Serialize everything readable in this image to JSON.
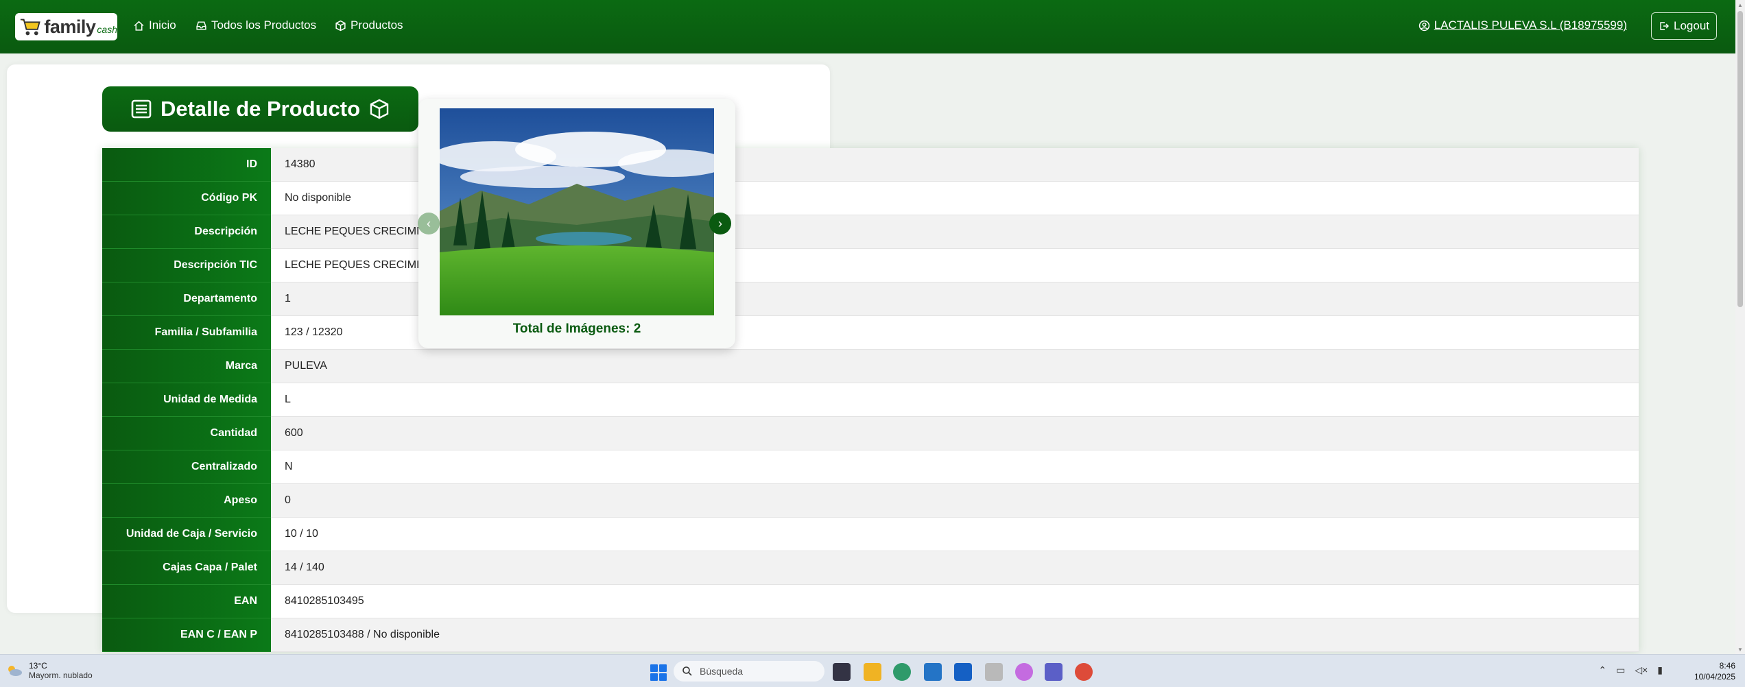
{
  "navbar": {
    "logo": {
      "word1": "family",
      "word2": "cash"
    },
    "items": [
      {
        "label": "Inicio",
        "icon": "home-icon"
      },
      {
        "label": "Todos los Productos",
        "icon": "inbox-icon"
      },
      {
        "label": "Productos",
        "icon": "box-icon"
      }
    ],
    "user": "LACTALIS PULEVA S.L (B18975599)",
    "logout": "Logout",
    "accent": "#0b6a12"
  },
  "title": "Detalle de Producto",
  "details": [
    {
      "label": "ID",
      "value": "14380"
    },
    {
      "label": "Código PK",
      "value": "No disponible"
    },
    {
      "label": "Descripción",
      "value": "LECHE PEQUES CRECIMIENTO"
    },
    {
      "label": "Descripción TIC",
      "value": "LECHE PEQUES CRECIMI"
    },
    {
      "label": "Departamento",
      "value": "1"
    },
    {
      "label": "Familia / Subfamilia",
      "value": "123 / 12320"
    },
    {
      "label": "Marca",
      "value": "PULEVA"
    },
    {
      "label": "Unidad de Medida",
      "value": "L"
    },
    {
      "label": "Cantidad",
      "value": "600"
    },
    {
      "label": "Centralizado",
      "value": "N"
    },
    {
      "label": "Apeso",
      "value": "0"
    },
    {
      "label": "Unidad de Caja / Servicio",
      "value": "10 / 10"
    },
    {
      "label": "Cajas Capa / Palet",
      "value": "14 / 140"
    },
    {
      "label": "EAN",
      "value": "8410285103495"
    },
    {
      "label": "EAN C / EAN P",
      "value": "8410285103488 / No disponible"
    }
  ],
  "gallery": {
    "total": "Total de Imágenes: 2"
  },
  "taskbar": {
    "weather_temp": "13°C",
    "weather_desc": "Mayorm. nublado",
    "search_placeholder": "Búsqueda",
    "time": "8:46",
    "date": "10/04/2025"
  }
}
